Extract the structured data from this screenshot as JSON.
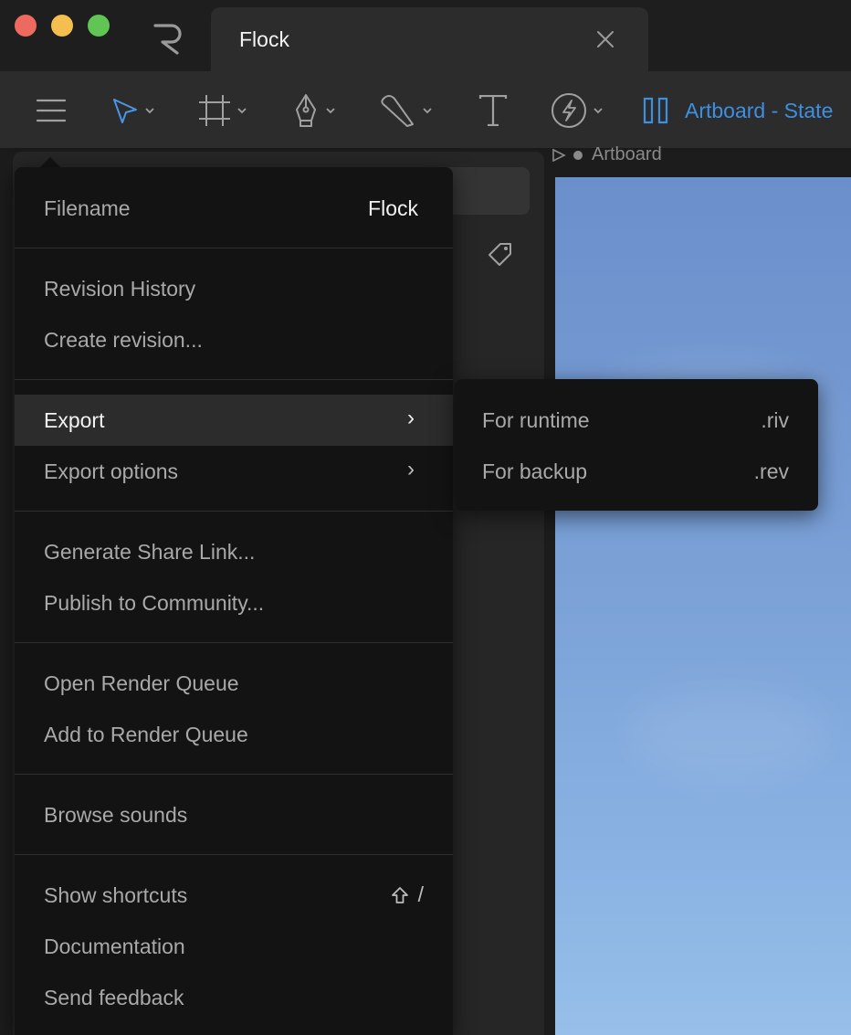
{
  "window": {
    "tab_title": "Flock"
  },
  "toolbar": {
    "tools": [
      {
        "icon": "hamburger-menu-icon"
      },
      {
        "icon": "select-arrow-icon",
        "active": true
      },
      {
        "icon": "artboard-frame-icon"
      },
      {
        "icon": "pen-tool-icon"
      },
      {
        "icon": "procedural-shape-icon"
      },
      {
        "icon": "text-tool-icon"
      },
      {
        "icon": "bolt-circle-icon"
      }
    ],
    "artboard_label": "Artboard - State",
    "accent_color": "#3f8fe0"
  },
  "canvas": {
    "artboard_tag": "Artboard"
  },
  "menu": {
    "filename_label": "Filename",
    "filename_value": "Flock",
    "revision_history": "Revision History",
    "create_revision": "Create revision...",
    "export": "Export",
    "export_options": "Export options",
    "generate_share_link": "Generate Share Link...",
    "publish_to_community": "Publish to Community...",
    "open_render_queue": "Open Render Queue",
    "add_to_render_queue": "Add to Render Queue",
    "browse_sounds": "Browse sounds",
    "show_shortcuts": "Show shortcuts",
    "show_shortcuts_key": "/",
    "documentation": "Documentation",
    "send_feedback": "Send feedback",
    "submenu_arrow": "›"
  },
  "export_submenu": {
    "items": [
      {
        "label": "For runtime",
        "ext": ".riv"
      },
      {
        "label": "For backup",
        "ext": ".rev"
      }
    ]
  }
}
